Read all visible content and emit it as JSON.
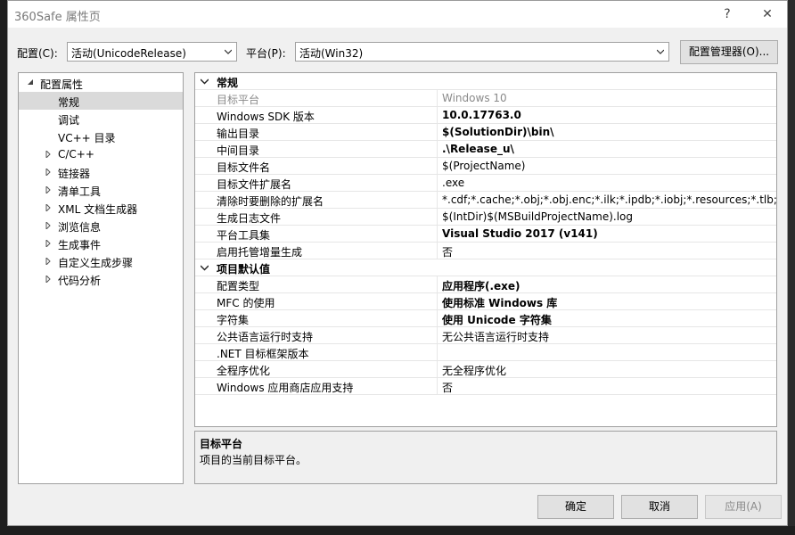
{
  "window": {
    "title": "360Safe 属性页",
    "help": "?",
    "close": "✕"
  },
  "config": {
    "label": "配置(C):",
    "value": "活动(UnicodeRelease)"
  },
  "platform": {
    "label": "平台(P):",
    "value": "活动(Win32)"
  },
  "config_manager": "配置管理器(O)...",
  "tree": {
    "root": "配置属性",
    "items": [
      {
        "label": "常规",
        "expandable": false,
        "selected": true
      },
      {
        "label": "调试",
        "expandable": false
      },
      {
        "label": "VC++ 目录",
        "expandable": false
      },
      {
        "label": "C/C++",
        "expandable": true
      },
      {
        "label": "链接器",
        "expandable": true
      },
      {
        "label": "清单工具",
        "expandable": true
      },
      {
        "label": "XML 文档生成器",
        "expandable": true
      },
      {
        "label": "浏览信息",
        "expandable": true
      },
      {
        "label": "生成事件",
        "expandable": true
      },
      {
        "label": "自定义生成步骤",
        "expandable": true
      },
      {
        "label": "代码分析",
        "expandable": true
      }
    ]
  },
  "grid": {
    "sections": [
      {
        "title": "常规",
        "rows": [
          {
            "name": "目标平台",
            "value": "Windows 10",
            "gray": true
          },
          {
            "name": "Windows SDK 版本",
            "value": "10.0.17763.0",
            "bold": true
          },
          {
            "name": "输出目录",
            "value": "$(SolutionDir)\\bin\\",
            "bold": true
          },
          {
            "name": "中间目录",
            "value": ".\\Release_u\\",
            "bold": true
          },
          {
            "name": "目标文件名",
            "value": "$(ProjectName)"
          },
          {
            "name": "目标文件扩展名",
            "value": ".exe"
          },
          {
            "name": "清除时要删除的扩展名",
            "value": "*.cdf;*.cache;*.obj;*.obj.enc;*.ilk;*.ipdb;*.iobj;*.resources;*.tlb;*.tli;*.t"
          },
          {
            "name": "生成日志文件",
            "value": "$(IntDir)$(MSBuildProjectName).log"
          },
          {
            "name": "平台工具集",
            "value": "Visual Studio 2017 (v141)",
            "bold": true
          },
          {
            "name": "启用托管增量生成",
            "value": "否"
          }
        ]
      },
      {
        "title": "项目默认值",
        "rows": [
          {
            "name": "配置类型",
            "value": "应用程序(.exe)",
            "bold": true
          },
          {
            "name": "MFC 的使用",
            "value": "使用标准 Windows 库",
            "bold": true
          },
          {
            "name": "字符集",
            "value": "使用 Unicode 字符集",
            "bold": true
          },
          {
            "name": "公共语言运行时支持",
            "value": "无公共语言运行时支持"
          },
          {
            "name": ".NET 目标框架版本",
            "value": ""
          },
          {
            "name": "全程序优化",
            "value": "无全程序优化"
          },
          {
            "name": "Windows 应用商店应用支持",
            "value": "否"
          }
        ]
      }
    ]
  },
  "description": {
    "title": "目标平台",
    "text": "项目的当前目标平台。"
  },
  "buttons": {
    "ok": "确定",
    "cancel": "取消",
    "apply": "应用(A)"
  }
}
